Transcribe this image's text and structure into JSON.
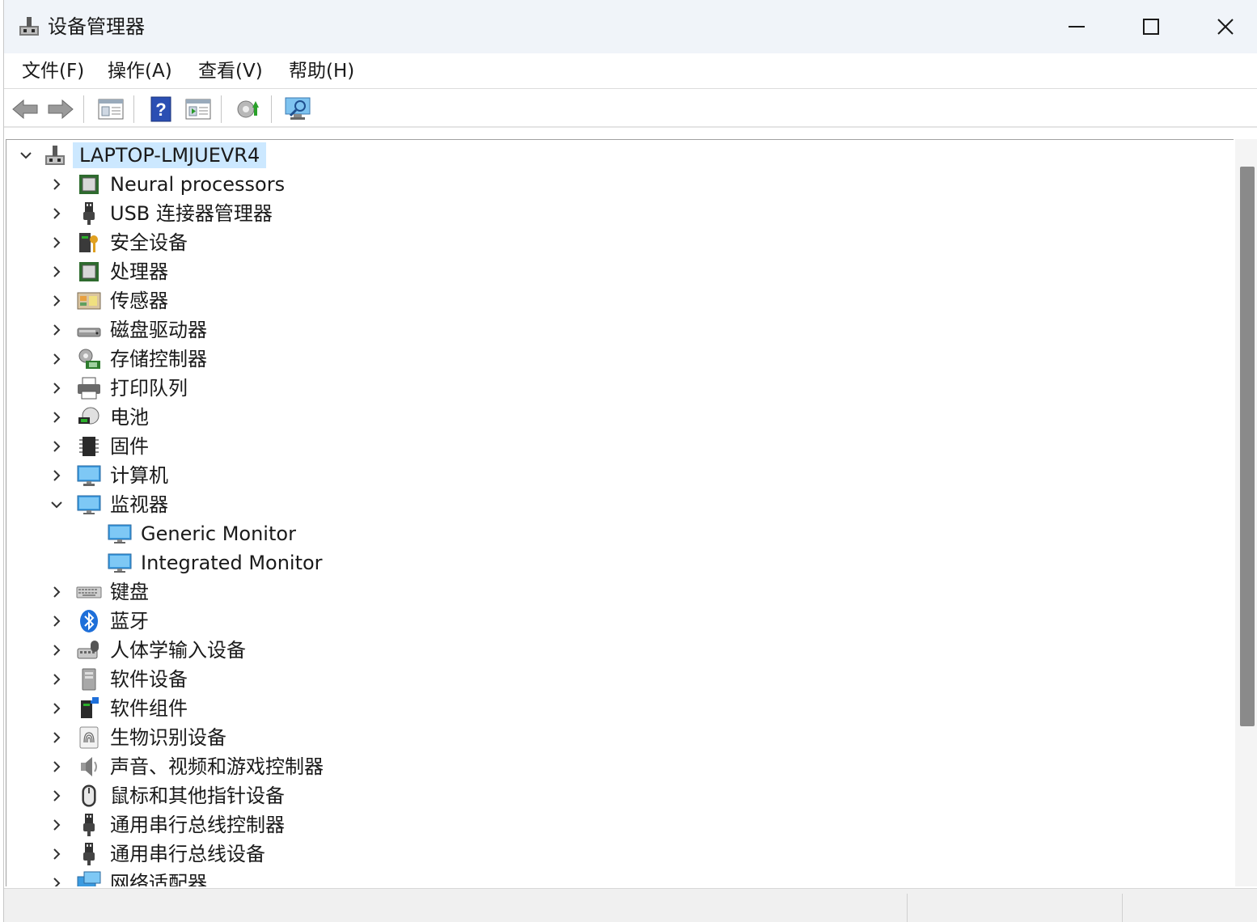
{
  "window": {
    "title": "设备管理器"
  },
  "menu": {
    "file": "文件(F)",
    "action": "操作(A)",
    "view": "查看(V)",
    "help": "帮助(H)"
  },
  "toolbar": {
    "icons": [
      "back-arrow-icon",
      "forward-arrow-icon",
      "properties-icon",
      "help-icon",
      "update-driver-icon",
      "uninstall-device-icon",
      "scan-hardware-icon"
    ]
  },
  "tree": {
    "root": "LAPTOP-LMJUEVR4",
    "items": [
      {
        "label": "Neural processors",
        "icon": "processor-icon",
        "expanded": false
      },
      {
        "label": "USB 连接器管理器",
        "icon": "usb-plug-icon",
        "expanded": false
      },
      {
        "label": "安全设备",
        "icon": "security-key-icon",
        "expanded": false
      },
      {
        "label": "处理器",
        "icon": "processor-icon",
        "expanded": false
      },
      {
        "label": "传感器",
        "icon": "sensor-icon",
        "expanded": false
      },
      {
        "label": "磁盘驱动器",
        "icon": "disk-drive-icon",
        "expanded": false
      },
      {
        "label": "存储控制器",
        "icon": "storage-controller-icon",
        "expanded": false
      },
      {
        "label": "打印队列",
        "icon": "printer-icon",
        "expanded": false
      },
      {
        "label": "电池",
        "icon": "battery-icon",
        "expanded": false
      },
      {
        "label": "固件",
        "icon": "firmware-chip-icon",
        "expanded": false
      },
      {
        "label": "计算机",
        "icon": "computer-monitor-icon",
        "expanded": false
      },
      {
        "label": "监视器",
        "icon": "monitor-icon",
        "expanded": true,
        "children": [
          "Generic Monitor",
          "Integrated Monitor"
        ]
      },
      {
        "label": "键盘",
        "icon": "keyboard-icon",
        "expanded": false
      },
      {
        "label": "蓝牙",
        "icon": "bluetooth-icon",
        "expanded": false
      },
      {
        "label": "人体学输入设备",
        "icon": "hid-icon",
        "expanded": false
      },
      {
        "label": "软件设备",
        "icon": "software-device-icon",
        "expanded": false
      },
      {
        "label": "软件组件",
        "icon": "software-component-icon",
        "expanded": false
      },
      {
        "label": "生物识别设备",
        "icon": "fingerprint-icon",
        "expanded": false
      },
      {
        "label": "声音、视频和游戏控制器",
        "icon": "speaker-icon",
        "expanded": false
      },
      {
        "label": "鼠标和其他指针设备",
        "icon": "mouse-icon",
        "expanded": false
      },
      {
        "label": "通用串行总线控制器",
        "icon": "usb-plug-icon",
        "expanded": false
      },
      {
        "label": "通用串行总线设备",
        "icon": "usb-plug-icon",
        "expanded": false
      },
      {
        "label": "网络适配器",
        "icon": "network-adapter-icon",
        "expanded": false
      }
    ]
  },
  "colors": {
    "titlebar_bg": "#f0f4f9",
    "root_highlight": "#cce8ff",
    "scroll_thumb": "#8a8a8a"
  }
}
